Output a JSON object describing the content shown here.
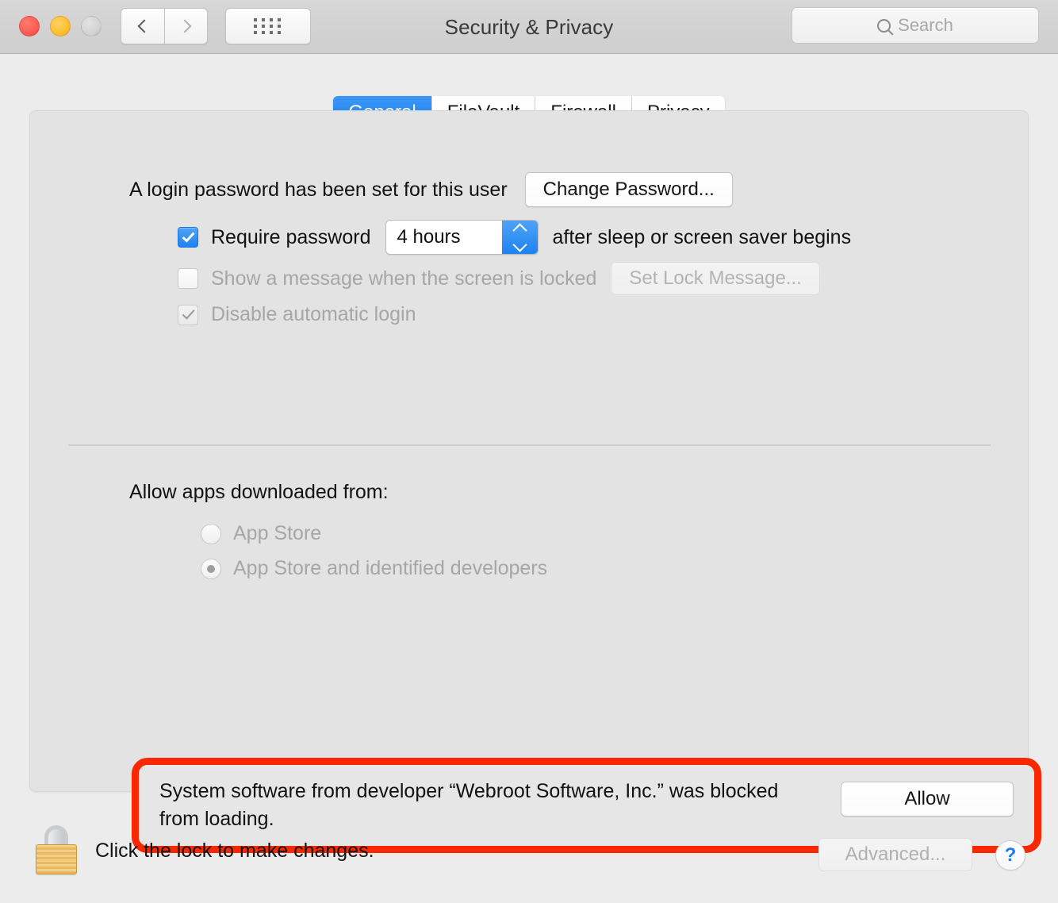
{
  "window": {
    "title": "Security & Privacy",
    "traffic_lights": {
      "close": "close-button",
      "minimize": "minimize-button",
      "zoom": "zoom-button"
    },
    "nav": {
      "back": "back-icon",
      "forward": "forward-icon"
    },
    "show_all": "show-all-grid-icon"
  },
  "search": {
    "placeholder": "Search",
    "value": "",
    "icon": "search-icon"
  },
  "tabs": [
    {
      "label": "General",
      "active": true
    },
    {
      "label": "FileVault",
      "active": false
    },
    {
      "label": "Firewall",
      "active": false
    },
    {
      "label": "Privacy",
      "active": false
    }
  ],
  "general": {
    "password_status": "A login password has been set for this user",
    "change_password_button": "Change Password...",
    "require_password": {
      "checked": true,
      "enabled": true,
      "label": "Require password",
      "interval_value": "4 hours",
      "suffix": "after sleep or screen saver begins",
      "stepper_icon": "stepper-up-down-icon"
    },
    "show_message": {
      "checked": false,
      "enabled": false,
      "label": "Show a message when the screen is locked",
      "button_label": "Set Lock Message...",
      "button_enabled": false
    },
    "disable_auto_login": {
      "checked": true,
      "enabled": false,
      "label": "Disable automatic login"
    },
    "allow_apps_header": "Allow apps downloaded from:",
    "allow_apps_options": [
      {
        "label": "App Store",
        "selected": false,
        "enabled": false
      },
      {
        "label": "App Store and identified developers",
        "selected": true,
        "enabled": false
      }
    ],
    "blocked_alert": {
      "message": "System software from developer “Webroot Software, Inc.” was blocked from loading.",
      "button_label": "Allow",
      "highlight_color": "#fa2800"
    }
  },
  "footer": {
    "lock_icon": "lock-closed-icon",
    "lock_hint": "Click the lock to make changes.",
    "advanced_button": "Advanced...",
    "advanced_enabled": false,
    "help_button": "?"
  },
  "colors": {
    "accent_blue": "#1d82f2",
    "alert_red": "#fa2800",
    "panel_bg": "#e3e3e3",
    "window_bg": "#ececec",
    "toolbar_bg": "#d4d3d4"
  }
}
